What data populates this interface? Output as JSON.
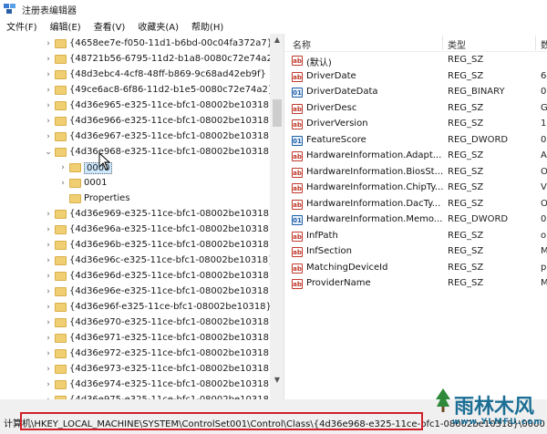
{
  "window": {
    "title": "注册表编辑器"
  },
  "menu": [
    "文件(F)",
    "编辑(E)",
    "查看(V)",
    "收藏夹(A)",
    "帮助(H)"
  ],
  "tree": [
    {
      "label": "{4658ee7e-f050-11d1-b6bd-00c04fa372a7}",
      "level": 0,
      "expander": "›"
    },
    {
      "label": "{48721b56-6795-11d2-b1a8-0080c72e74a2}",
      "level": 0,
      "expander": "›"
    },
    {
      "label": "{48d3ebc4-4cf8-48ff-b869-9c68ad42eb9f}",
      "level": 0,
      "expander": "›"
    },
    {
      "label": "{49ce6ac8-6f86-11d2-b1e5-0080c72e74a2}",
      "level": 0,
      "expander": "›"
    },
    {
      "label": "{4d36e965-e325-11ce-bfc1-08002be10318}",
      "level": 0,
      "expander": "›"
    },
    {
      "label": "{4d36e966-e325-11ce-bfc1-08002be10318}",
      "level": 0,
      "expander": "›"
    },
    {
      "label": "{4d36e967-e325-11ce-bfc1-08002be10318}",
      "level": 0,
      "expander": "›"
    },
    {
      "label": "{4d36e968-e325-11ce-bfc1-08002be10318}",
      "level": 0,
      "expander": "⌄"
    },
    {
      "label": "0000",
      "level": 1,
      "expander": "›",
      "selected": true
    },
    {
      "label": "0001",
      "level": 1,
      "expander": "›"
    },
    {
      "label": "Properties",
      "level": 1,
      "expander": ""
    },
    {
      "label": "{4d36e969-e325-11ce-bfc1-08002be10318}",
      "level": 0,
      "expander": "›"
    },
    {
      "label": "{4d36e96a-e325-11ce-bfc1-08002be10318}",
      "level": 0,
      "expander": "›"
    },
    {
      "label": "{4d36e96b-e325-11ce-bfc1-08002be10318}",
      "level": 0,
      "expander": "›"
    },
    {
      "label": "{4d36e96c-e325-11ce-bfc1-08002be10318}",
      "level": 0,
      "expander": "›"
    },
    {
      "label": "{4d36e96d-e325-11ce-bfc1-08002be10318}",
      "level": 0,
      "expander": "›"
    },
    {
      "label": "{4d36e96e-e325-11ce-bfc1-08002be10318}",
      "level": 0,
      "expander": "›"
    },
    {
      "label": "{4d36e96f-e325-11ce-bfc1-08002be10318}",
      "level": 0,
      "expander": "›"
    },
    {
      "label": "{4d36e970-e325-11ce-bfc1-08002be10318}",
      "level": 0,
      "expander": "›"
    },
    {
      "label": "{4d36e971-e325-11ce-bfc1-08002be10318}",
      "level": 0,
      "expander": "›"
    },
    {
      "label": "{4d36e972-e325-11ce-bfc1-08002be10318}",
      "level": 0,
      "expander": "›"
    },
    {
      "label": "{4d36e973-e325-11ce-bfc1-08002be10318}",
      "level": 0,
      "expander": "›"
    },
    {
      "label": "{4d36e974-e325-11ce-bfc1-08002be10318}",
      "level": 0,
      "expander": "›"
    },
    {
      "label": "{4d36e975-e325-11ce-bfc1-08002be10318}",
      "level": 0,
      "expander": "›"
    }
  ],
  "list": {
    "columns": [
      "名称",
      "类型",
      "数"
    ],
    "rows": [
      {
        "name": "(默认)",
        "type": "REG_SZ",
        "data": "",
        "icon": "sz"
      },
      {
        "name": "DriverDate",
        "type": "REG_SZ",
        "data": "6-",
        "icon": "sz"
      },
      {
        "name": "DriverDateData",
        "type": "REG_BINARY",
        "data": "00",
        "icon": "bin"
      },
      {
        "name": "DriverDesc",
        "type": "REG_SZ",
        "data": "G",
        "icon": "sz"
      },
      {
        "name": "DriverVersion",
        "type": "REG_SZ",
        "data": "10",
        "icon": "sz"
      },
      {
        "name": "FeatureScore",
        "type": "REG_DWORD",
        "data": "0x",
        "icon": "bin"
      },
      {
        "name": "HardwareInformation.Adapt...",
        "type": "REG_SZ",
        "data": "A",
        "icon": "sz"
      },
      {
        "name": "HardwareInformation.BiosSt...",
        "type": "REG_SZ",
        "data": "O",
        "icon": "sz"
      },
      {
        "name": "HardwareInformation.ChipTy...",
        "type": "REG_SZ",
        "data": "Vi",
        "icon": "sz"
      },
      {
        "name": "HardwareInformation.DacTy...",
        "type": "REG_SZ",
        "data": "O",
        "icon": "sz"
      },
      {
        "name": "HardwareInformation.Memo...",
        "type": "REG_DWORD",
        "data": "0x",
        "icon": "bin"
      },
      {
        "name": "InfPath",
        "type": "REG_SZ",
        "data": "oi",
        "icon": "sz"
      },
      {
        "name": "InfSection",
        "type": "REG_SZ",
        "data": "M",
        "icon": "sz"
      },
      {
        "name": "MatchingDeviceId",
        "type": "REG_SZ",
        "data": "pc",
        "icon": "sz"
      },
      {
        "name": "ProviderName",
        "type": "REG_SZ",
        "data": "M",
        "icon": "sz"
      }
    ]
  },
  "status": {
    "path": "计算机\\HKEY_LOCAL_MACHINE\\SYSTEM\\ControlSet001\\Control\\Class\\{4d36e968-e325-11ce-bfc1-08002be10318}\\0000",
    "footer": "   "
  },
  "watermark": {
    "text": "雨林木风",
    "url": "www.YLMFU.com"
  },
  "colors": {
    "highlight": "#d11f2a",
    "folder": "#f0cf72",
    "selected_bg": "#cce8ff",
    "watermark": "#1b6f95"
  }
}
